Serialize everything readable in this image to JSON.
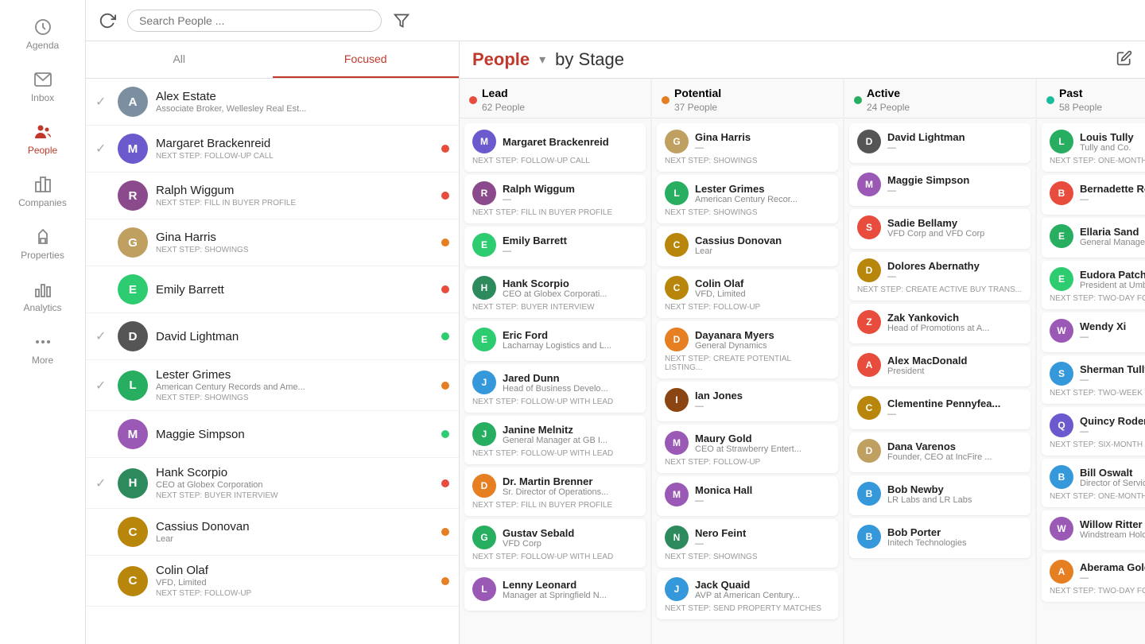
{
  "sidebar": {
    "items": [
      {
        "label": "Agenda",
        "icon": "clock"
      },
      {
        "label": "Inbox",
        "icon": "mail"
      },
      {
        "label": "People",
        "icon": "people",
        "active": true
      },
      {
        "label": "Companies",
        "icon": "companies"
      },
      {
        "label": "Properties",
        "icon": "tag"
      },
      {
        "label": "Analytics",
        "icon": "bar-chart"
      },
      {
        "label": "More",
        "icon": "more"
      }
    ]
  },
  "topbar": {
    "search_placeholder": "Search People ...",
    "refresh_icon": "refresh",
    "filter_icon": "filter"
  },
  "list_panel": {
    "tabs": [
      {
        "label": "All",
        "active": false
      },
      {
        "label": "Focused",
        "active": true
      }
    ],
    "items": [
      {
        "name": "Alex Estate",
        "sub": "Associate Broker, Wellesley Real Est...",
        "step": null,
        "avatar_color": "#7b8fa0",
        "initials": "A",
        "has_photo": true,
        "dot_color": null,
        "checked": true
      },
      {
        "name": "Margaret Brackenreid",
        "sub": null,
        "step": "NEXT STEP: FOLLOW-UP CALL",
        "avatar_color": "#6a5acd",
        "initials": "M",
        "has_photo": false,
        "dot_color": "#e74c3c",
        "checked": true
      },
      {
        "name": "Ralph Wiggum",
        "sub": null,
        "step": "NEXT STEP: FILL IN BUYER PROFILE",
        "avatar_color": "#8b4a8b",
        "initials": "R",
        "has_photo": false,
        "dot_color": "#e74c3c",
        "checked": false
      },
      {
        "name": "Gina Harris",
        "sub": null,
        "step": "NEXT STEP: SHOWINGS",
        "avatar_color": "#c0a060",
        "initials": "G",
        "has_photo": true,
        "dot_color": "#e67e22",
        "checked": false
      },
      {
        "name": "Emily Barrett",
        "sub": null,
        "step": null,
        "avatar_color": "#2ecc71",
        "initials": "E",
        "has_photo": false,
        "dot_color": "#e74c3c",
        "checked": false
      },
      {
        "name": "David Lightman",
        "sub": null,
        "step": null,
        "avatar_color": "#555",
        "initials": "D",
        "has_photo": false,
        "dot_color": "#2ecc71",
        "checked": true
      },
      {
        "name": "Lester Grimes",
        "sub": "American Century Records and Ame...",
        "step": "NEXT STEP: SHOWINGS",
        "avatar_color": "#27ae60",
        "initials": "L",
        "has_photo": false,
        "dot_color": "#e67e22",
        "checked": true
      },
      {
        "name": "Maggie Simpson",
        "sub": null,
        "step": null,
        "avatar_color": "#9b59b6",
        "initials": "M",
        "has_photo": false,
        "dot_color": "#2ecc71",
        "checked": false
      },
      {
        "name": "Hank Scorpio",
        "sub": "CEO at Globex Corporation",
        "step": "NEXT STEP: BUYER INTERVIEW",
        "avatar_color": "#2c8a5c",
        "initials": "H",
        "has_photo": false,
        "dot_color": "#e74c3c",
        "checked": true
      },
      {
        "name": "Cassius Donovan",
        "sub": "Lear",
        "step": null,
        "avatar_color": "#b8860b",
        "initials": "C",
        "has_photo": false,
        "dot_color": "#e67e22",
        "checked": false
      },
      {
        "name": "Colin Olaf",
        "sub": "VFD, Limited",
        "step": "NEXT STEP: FOLLOW-UP",
        "avatar_color": "#b8860b",
        "initials": "C",
        "has_photo": false,
        "dot_color": "#e67e22",
        "checked": false
      }
    ]
  },
  "kanban": {
    "title": "People",
    "subtitle": "by Stage",
    "columns": [
      {
        "name": "Lead",
        "count": "62 People",
        "dot_color": "#e74c3c",
        "cards": [
          {
            "name": "Margaret Brackenreid",
            "sub": "",
            "step": "NEXT STEP: FOLLOW-UP CALL",
            "initials": "M",
            "color": "#6a5acd"
          },
          {
            "name": "Ralph Wiggum",
            "sub": "—",
            "step": "NEXT STEP: FILL IN BUYER PROFILE",
            "initials": "R",
            "color": "#8b4a8b"
          },
          {
            "name": "Emily Barrett",
            "sub": "—",
            "step": "",
            "initials": "E",
            "color": "#2ecc71"
          },
          {
            "name": "Hank Scorpio",
            "sub": "CEO at Globex Corporati...",
            "step": "NEXT STEP: BUYER INTERVIEW",
            "initials": "H",
            "color": "#2c8a5c"
          },
          {
            "name": "Eric Ford",
            "sub": "Lacharnay Logistics and L...",
            "step": "",
            "initials": "E",
            "color": "#2ecc71"
          },
          {
            "name": "Jared Dunn",
            "sub": "Head of Business Develo...",
            "step": "NEXT STEP: FOLLOW-UP WITH LEAD",
            "initials": "J",
            "color": "#3498db"
          },
          {
            "name": "Janine Melnitz",
            "sub": "General Manager at GB I...",
            "step": "NEXT STEP: FOLLOW-UP WITH LEAD",
            "initials": "J",
            "color": "#27ae60"
          },
          {
            "name": "Dr. Martin Brenner",
            "sub": "Sr. Director of Operations...",
            "step": "NEXT STEP: FILL IN BUYER PROFILE",
            "initials": "D",
            "color": "#e67e22"
          },
          {
            "name": "Gustav Sebald",
            "sub": "VFD Corp",
            "step": "NEXT STEP: FOLLOW-UP WITH LEAD",
            "initials": "G",
            "color": "#27ae60"
          },
          {
            "name": "Lenny Leonard",
            "sub": "Manager at Springfield N...",
            "step": "",
            "initials": "L",
            "color": "#9b59b6",
            "has_photo": true
          }
        ]
      },
      {
        "name": "Potential",
        "count": "37 People",
        "dot_color": "#e67e22",
        "cards": [
          {
            "name": "Gina Harris",
            "sub": "—",
            "step": "NEXT STEP: SHOWINGS",
            "initials": "G",
            "color": "#c0a060",
            "has_photo": true
          },
          {
            "name": "Lester Grimes",
            "sub": "American Century Recor...",
            "step": "NEXT STEP: SHOWINGS",
            "initials": "L",
            "color": "#27ae60"
          },
          {
            "name": "Cassius Donovan",
            "sub": "Lear",
            "step": "",
            "initials": "C",
            "color": "#b8860b"
          },
          {
            "name": "Colin Olaf",
            "sub": "VFD, Limited",
            "step": "NEXT STEP: FOLLOW-UP",
            "initials": "C",
            "color": "#b8860b"
          },
          {
            "name": "Dayanara Myers",
            "sub": "General Dynamics",
            "step": "NEXT STEP: CREATE POTENTIAL LISTING...",
            "initials": "D",
            "color": "#e67e22"
          },
          {
            "name": "Ian Jones",
            "sub": "—",
            "step": "",
            "initials": "I",
            "color": "#8b4513"
          },
          {
            "name": "Maury Gold",
            "sub": "CEO at Strawberry Entert...",
            "step": "NEXT STEP: FOLLOW-UP",
            "initials": "M",
            "color": "#9b59b6"
          },
          {
            "name": "Monica Hall",
            "sub": "—",
            "step": "",
            "initials": "M",
            "color": "#9b59b6"
          },
          {
            "name": "Nero Feint",
            "sub": "—",
            "step": "NEXT STEP: SHOWINGS",
            "initials": "N",
            "color": "#2c8a5c"
          },
          {
            "name": "Jack Quaid",
            "sub": "AVP at American Century...",
            "step": "NEXT STEP: SEND PROPERTY MATCHES",
            "initials": "J",
            "color": "#3498db"
          }
        ]
      },
      {
        "name": "Active",
        "count": "24 People",
        "dot_color": "#27ae60",
        "cards": [
          {
            "name": "David Lightman",
            "sub": "—",
            "step": "",
            "initials": "D",
            "color": "#555"
          },
          {
            "name": "Maggie Simpson",
            "sub": "—",
            "step": "",
            "initials": "M",
            "color": "#9b59b6"
          },
          {
            "name": "Sadie Bellamy",
            "sub": "VFD Corp and VFD Corp",
            "step": "",
            "initials": "S",
            "color": "#e74c3c"
          },
          {
            "name": "Dolores Abernathy",
            "sub": "—",
            "step": "NEXT STEP: CREATE ACTIVE BUY TRANS...",
            "initials": "D",
            "color": "#b8860b"
          },
          {
            "name": "Zak Yankovich",
            "sub": "Head of Promotions at A...",
            "step": "",
            "initials": "Z",
            "color": "#e74c3c"
          },
          {
            "name": "Alex MacDonald",
            "sub": "President",
            "step": "",
            "initials": "A",
            "color": "#e74c3c"
          },
          {
            "name": "Clementine Pennyfea...",
            "sub": "—",
            "step": "",
            "initials": "C",
            "color": "#b8860b"
          },
          {
            "name": "Dana Varenos",
            "sub": "Founder, CEO at IncFire ...",
            "step": "",
            "initials": "D",
            "color": "#c0a060",
            "has_photo": true
          },
          {
            "name": "Bob Newby",
            "sub": "LR Labs and LR Labs",
            "step": "",
            "initials": "B",
            "color": "#3498db"
          },
          {
            "name": "Bob Porter",
            "sub": "Initech Technologies",
            "step": "",
            "initials": "B",
            "color": "#3498db"
          }
        ]
      },
      {
        "name": "Past",
        "count": "58 People",
        "dot_color": "#1abc9c",
        "cards": [
          {
            "name": "Louis Tully",
            "sub": "Tully and Co.",
            "step": "NEXT STEP: ONE-MONTH FOLLOW-UP",
            "initials": "L",
            "color": "#27ae60"
          },
          {
            "name": "Bernadette Rostenko...",
            "sub": "—",
            "step": "",
            "initials": "B",
            "color": "#e74c3c"
          },
          {
            "name": "Ellaria Sand",
            "sub": "General Manager",
            "step": "",
            "initials": "E",
            "color": "#27ae60"
          },
          {
            "name": "Eudora Patch",
            "sub": "President at Umbrella Labs",
            "step": "NEXT STEP: TWO-DAY FOLLOW-UP",
            "initials": "E",
            "color": "#2ecc71"
          },
          {
            "name": "Wendy Xi",
            "sub": "—",
            "step": "",
            "initials": "W",
            "color": "#9b59b6"
          },
          {
            "name": "Sherman Tully",
            "sub": "—",
            "step": "NEXT STEP: TWO-WEEK FOLLOW-UP",
            "initials": "S",
            "color": "#3498db"
          },
          {
            "name": "Quincy Rodenstock",
            "sub": "—",
            "step": "NEXT STEP: SIX-MONTH FOLLOW-UP",
            "initials": "Q",
            "color": "#6a5acd"
          },
          {
            "name": "Bill Oswalt",
            "sub": "Director of Services",
            "step": "NEXT STEP: ONE-MONTH FOLLOW-UP",
            "initials": "B",
            "color": "#3498db"
          },
          {
            "name": "Willow Ritter",
            "sub": "Windstream Holdings",
            "step": "",
            "initials": "W",
            "color": "#9b59b6"
          },
          {
            "name": "Aberama Gold",
            "sub": "—",
            "step": "NEXT STEP: TWO-DAY FOLLOW-UP",
            "initials": "A",
            "color": "#e67e22"
          }
        ]
      }
    ]
  }
}
